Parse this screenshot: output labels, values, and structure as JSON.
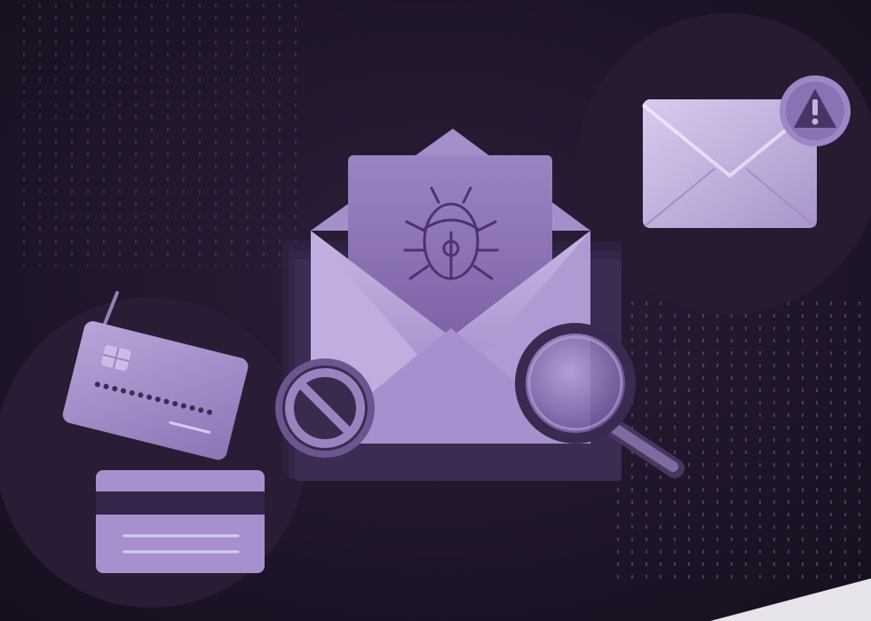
{
  "scene": {
    "subject": "email-phishing-security-illustration",
    "palette": {
      "background": "#1f1528",
      "background_dark": "#140d1b",
      "disc_dark": "#2b1d35",
      "envelope_light": "#b9a3d6",
      "envelope_mid": "#9f86c4",
      "letter": "#8c72b3",
      "bug_stroke": "#4c3370",
      "accent": "#c9b6e6",
      "corner_page": "#e6e3ea"
    },
    "icons": [
      "bug-icon",
      "warning-icon",
      "blocked-icon",
      "magnifier-icon",
      "credit-card-icon",
      "fish-hook-icon",
      "envelope-icon"
    ]
  }
}
